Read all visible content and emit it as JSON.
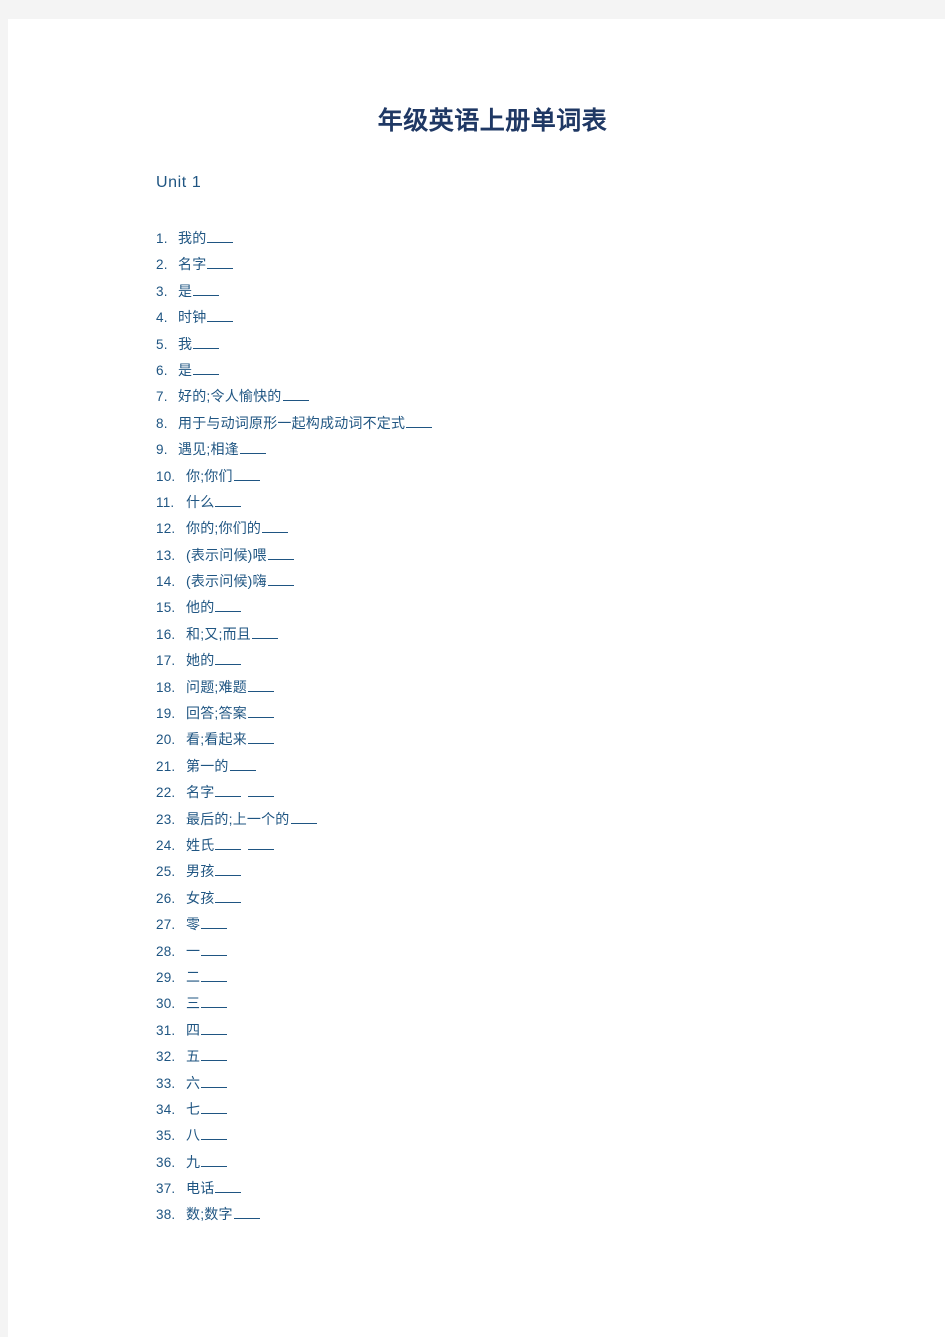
{
  "document": {
    "title": "年级英语上册单词表",
    "unit_heading": "Unit 1",
    "colors": {
      "title_text": "#1f3864",
      "body_text": "#1f5582",
      "page_background": "#ffffff",
      "viewer_background": "#f4f4f4"
    }
  },
  "word_list": [
    {
      "number": "1.",
      "term": "我的",
      "blanks": 1
    },
    {
      "number": "2.",
      "term": "名字",
      "blanks": 1
    },
    {
      "number": "3.",
      "term": "是",
      "blanks": 1
    },
    {
      "number": "4.",
      "term": "时钟",
      "blanks": 1
    },
    {
      "number": "5.",
      "term": "我",
      "blanks": 1
    },
    {
      "number": "6.",
      "term": "是",
      "blanks": 1
    },
    {
      "number": "7.",
      "term": "好的;令人愉快的",
      "blanks": 1
    },
    {
      "number": "8.",
      "term": "用于与动词原形一起构成动词不定式",
      "blanks": 1
    },
    {
      "number": "9.",
      "term": "遇见;相逢",
      "blanks": 1
    },
    {
      "number": "10.",
      "term": "你;你们",
      "blanks": 1
    },
    {
      "number": "11.",
      "term": "什么",
      "blanks": 1
    },
    {
      "number": "12.",
      "term": "你的;你们的",
      "blanks": 1
    },
    {
      "number": "13.",
      "term": "(表示问候)喂",
      "blanks": 1
    },
    {
      "number": "14.",
      "term": "(表示问候)嗨",
      "blanks": 1
    },
    {
      "number": "15.",
      "term": "他的",
      "blanks": 1
    },
    {
      "number": "16.",
      "term": "和;又;而且",
      "blanks": 1
    },
    {
      "number": "17.",
      "term": "她的",
      "blanks": 1
    },
    {
      "number": "18.",
      "term": "问题;难题",
      "blanks": 1
    },
    {
      "number": "19.",
      "term": "回答;答案",
      "blanks": 1
    },
    {
      "number": "20.",
      "term": "看;看起来",
      "blanks": 1
    },
    {
      "number": "21.",
      "term": "第一的",
      "blanks": 1
    },
    {
      "number": "22.",
      "term": "名字",
      "blanks": 2
    },
    {
      "number": "23.",
      "term": "最后的;上一个的",
      "blanks": 1
    },
    {
      "number": "24.",
      "term": "姓氏",
      "blanks": 2
    },
    {
      "number": "25.",
      "term": "男孩",
      "blanks": 1
    },
    {
      "number": "26.",
      "term": "女孩",
      "blanks": 1
    },
    {
      "number": "27.",
      "term": "零",
      "blanks": 1
    },
    {
      "number": "28.",
      "term": "一",
      "blanks": 1
    },
    {
      "number": "29.",
      "term": "二",
      "blanks": 1
    },
    {
      "number": "30.",
      "term": "三",
      "blanks": 1
    },
    {
      "number": "31.",
      "term": "四",
      "blanks": 1
    },
    {
      "number": "32.",
      "term": "五",
      "blanks": 1
    },
    {
      "number": "33.",
      "term": "六",
      "blanks": 1
    },
    {
      "number": "34.",
      "term": "七",
      "blanks": 1
    },
    {
      "number": "35.",
      "term": "八",
      "blanks": 1
    },
    {
      "number": "36.",
      "term": "九",
      "blanks": 1
    },
    {
      "number": "37.",
      "term": "电话",
      "blanks": 1
    },
    {
      "number": "38.",
      "term": "数;数字",
      "blanks": 1
    }
  ]
}
